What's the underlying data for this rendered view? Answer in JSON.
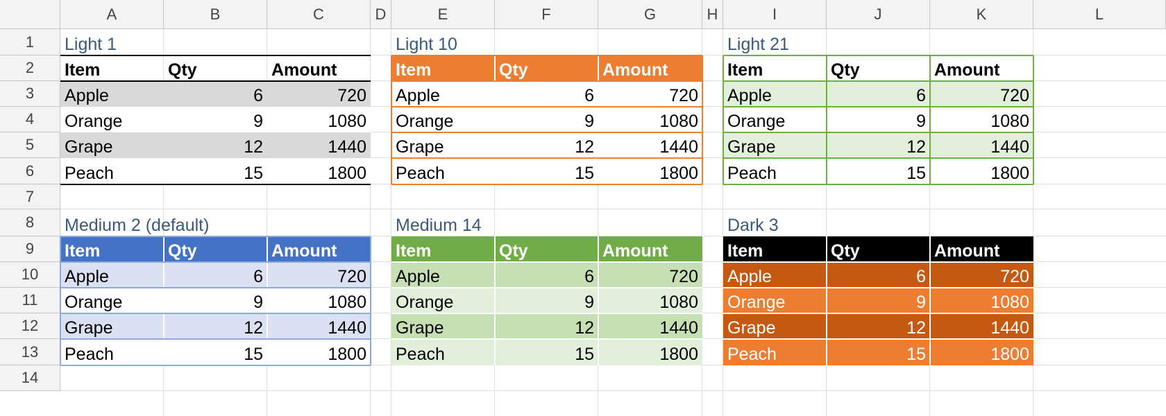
{
  "columns": [
    "A",
    "B",
    "C",
    "D",
    "E",
    "F",
    "G",
    "H",
    "I",
    "J",
    "K",
    "L"
  ],
  "rows": [
    "1",
    "2",
    "3",
    "4",
    "5",
    "6",
    "7",
    "8",
    "9",
    "10",
    "11",
    "12",
    "13",
    "14"
  ],
  "header_labels": [
    "Item",
    "Qty",
    "Amount"
  ],
  "items": [
    {
      "item": "Apple",
      "qty": "6",
      "amount": "720"
    },
    {
      "item": "Orange",
      "qty": "9",
      "amount": "1080"
    },
    {
      "item": "Grape",
      "qty": "12",
      "amount": "1440"
    },
    {
      "item": "Peach",
      "qty": "15",
      "amount": "1800"
    }
  ],
  "tables": [
    {
      "title": "Light 1",
      "style": "light1"
    },
    {
      "title": "Light 10",
      "style": "light10"
    },
    {
      "title": "Light 21",
      "style": "light21"
    },
    {
      "title": "Medium 2 (default)",
      "style": "medium2"
    },
    {
      "title": "Medium 14",
      "style": "medium14"
    },
    {
      "title": "Dark 3",
      "style": "dark3"
    }
  ],
  "colors": {
    "gridline": "#e0e0e0",
    "header_bg": "#f3f3f3",
    "title_text": "#3a5a7c",
    "light1_band": "#d9d9d9",
    "orange": "#ed7d31",
    "green": "#70ad47",
    "green_band": "#e2efda",
    "blue": "#4472c4",
    "blue_band": "#d9e1f2",
    "medium14_band_dark": "#c6e0b4",
    "medium14_band_light": "#e2efda",
    "dark3_band_dark": "#c65911",
    "dark3_band_light": "#ed7d31",
    "black": "#000000"
  }
}
